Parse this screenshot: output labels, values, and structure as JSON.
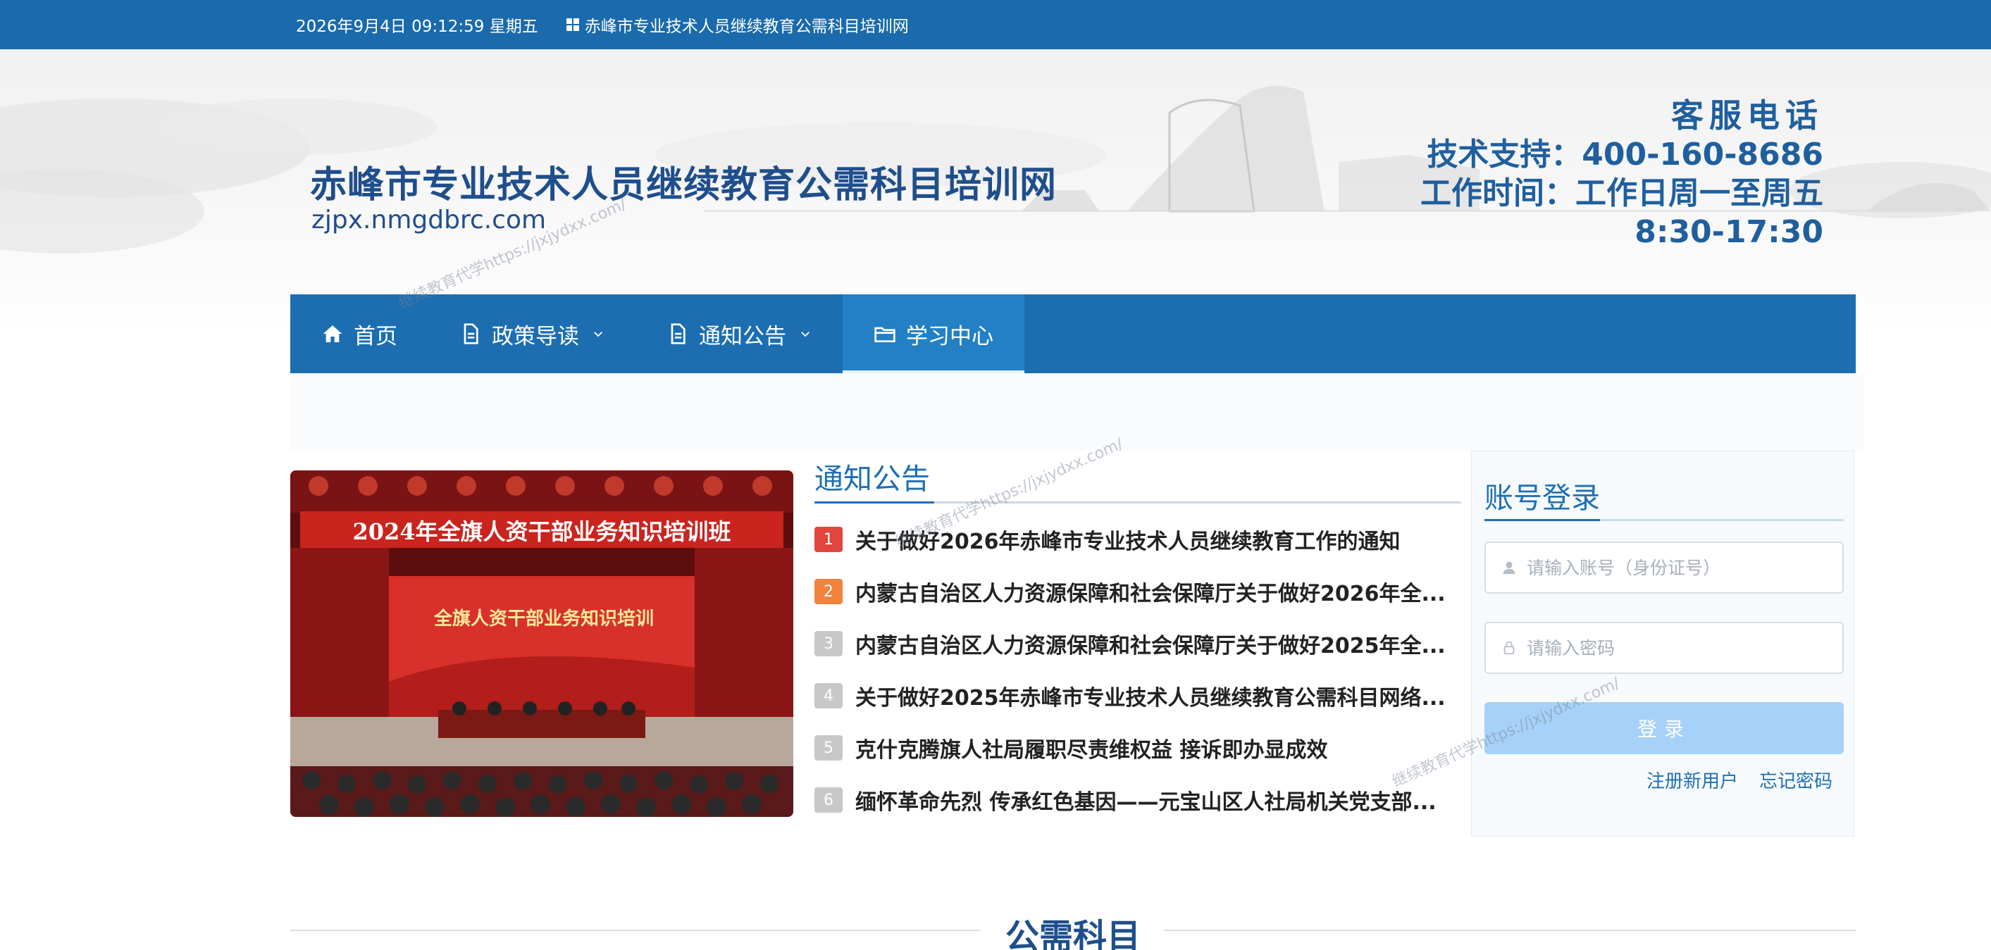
{
  "topbar": {
    "datetime": "2026年9月4日 09:12:59 星期五",
    "site_name": "赤峰市专业技术人员继续教育公需科目培训网"
  },
  "header": {
    "title": "赤峰市专业技术人员继续教育公需科目培训网",
    "domain": "zjpx.nmgdbrc.com",
    "service_title": "客服电话",
    "support": "技术支持：400-160-8686",
    "hours_label": "工作时间：工作日周一至周五",
    "hours_time": "8:30-17:30"
  },
  "nav": {
    "home": "首页",
    "policy": "政策导读",
    "notice": "通知公告",
    "study": "学习中心"
  },
  "photo": {
    "banner": "2024年全旗人资干部业务知识培训班",
    "screen": "全旗人资干部业务知识培训"
  },
  "notices": {
    "title": "通知公告",
    "items": [
      {
        "rank": "1",
        "text": "关于做好2026年赤峰市专业技术人员继续教育工作的通知"
      },
      {
        "rank": "2",
        "text": "内蒙古自治区人力资源保障和社会保障厅关于做好2026年全..."
      },
      {
        "rank": "3",
        "text": "内蒙古自治区人力资源保障和社会保障厅关于做好2025年全..."
      },
      {
        "rank": "4",
        "text": "关于做好2025年赤峰市专业技术人员继续教育公需科目网络..."
      },
      {
        "rank": "5",
        "text": "克什克腾旗人社局履职尽责维权益 接诉即办显成效"
      },
      {
        "rank": "6",
        "text": "缅怀革命先烈 传承红色基因——元宝山区人社局机关党支部..."
      }
    ]
  },
  "login": {
    "title": "账号登录",
    "username_placeholder": "请输入账号（身份证号）",
    "password_placeholder": "请输入密码",
    "button": "登录",
    "register": "注册新用户",
    "forgot": "忘记密码"
  },
  "section": {
    "title": "公需科目"
  },
  "watermark": "继续教育代学https://jxjydxx.com/",
  "colors": {
    "brand_blue": "#1c6eb0",
    "topbar_blue": "#1a6aac",
    "title_blue": "#1f4e8c",
    "login_button": "#a6d1f8"
  }
}
